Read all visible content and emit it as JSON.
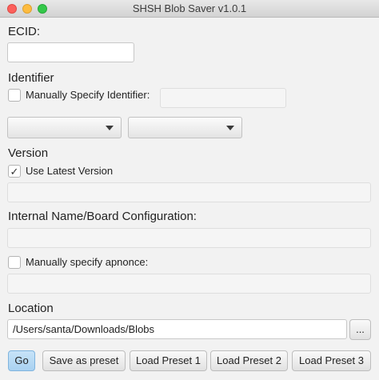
{
  "window": {
    "title": "SHSH Blob Saver v1.0.1"
  },
  "ecid": {
    "label": "ECID:",
    "value": ""
  },
  "identifier": {
    "label": "Identifier",
    "manual_checkbox_label": "Manually Specify Identifier:",
    "manual_checked": false,
    "value": "",
    "device_type_selected": "",
    "device_model_selected": ""
  },
  "version": {
    "label": "Version",
    "use_latest_label": "Use Latest Version",
    "use_latest_checked": true,
    "value": ""
  },
  "board": {
    "label": "Internal Name/Board Configuration:",
    "value": ""
  },
  "apnonce": {
    "checkbox_label": "Manually specify apnonce:",
    "checked": false,
    "value": ""
  },
  "location": {
    "label": "Location",
    "path": "/Users/santa/Downloads/Blobs",
    "browse_label": "..."
  },
  "buttons": {
    "go": "Go",
    "save_preset": "Save as preset",
    "load_preset_1": "Load Preset 1",
    "load_preset_2": "Load Preset 2",
    "load_preset_3": "Load Preset 3"
  }
}
